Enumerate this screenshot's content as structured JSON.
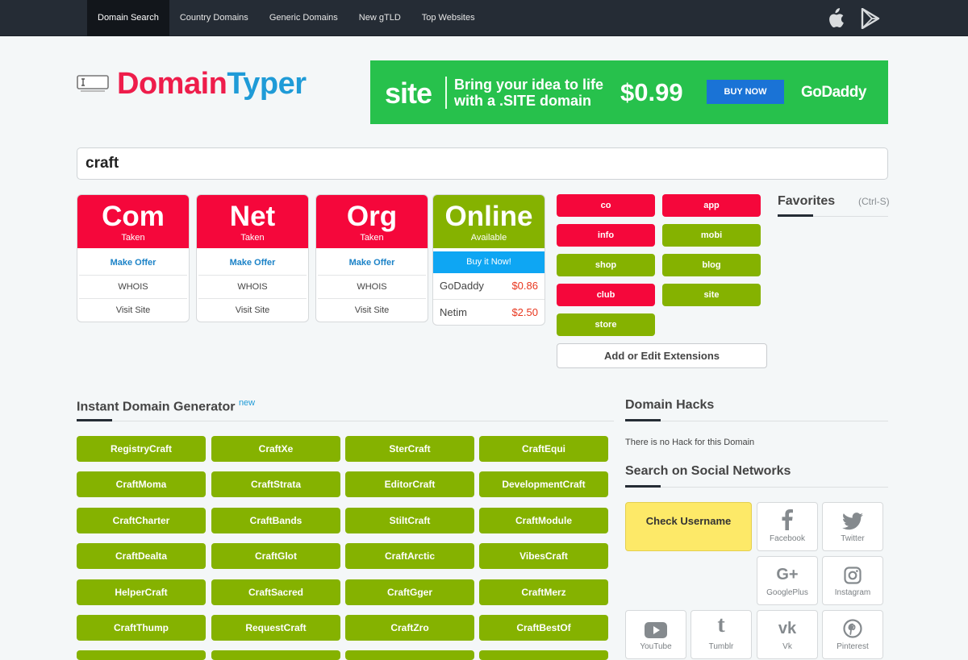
{
  "nav": {
    "items": [
      "Domain Search",
      "Country Domains",
      "Generic Domains",
      "New gTLD",
      "Top Websites"
    ],
    "active": 0
  },
  "logo": {
    "part1": "Domain",
    "part2": "Typer"
  },
  "ad": {
    "brand_word": "site",
    "message": "Bring your idea to life with a .SITE domain",
    "price": "$0.99",
    "button": "BUY NOW",
    "sponsor": "GoDaddy",
    "bg_color": "#27c14c"
  },
  "search": {
    "value": "craft"
  },
  "tld_cards": [
    {
      "name": "Com",
      "status": "Taken",
      "offer": "Make Offer",
      "whois": "WHOIS",
      "visit": "Visit Site"
    },
    {
      "name": "Net",
      "status": "Taken",
      "offer": "Make Offer",
      "whois": "WHOIS",
      "visit": "Visit Site"
    },
    {
      "name": "Org",
      "status": "Taken",
      "offer": "Make Offer",
      "whois": "WHOIS",
      "visit": "Visit Site"
    }
  ],
  "online_card": {
    "name": "Online",
    "status": "Available",
    "buy": "Buy it Now!",
    "registrars": [
      {
        "name": "GoDaddy",
        "price": "$0.86"
      },
      {
        "name": "Netim",
        "price": "$2.50"
      }
    ]
  },
  "extensions": [
    {
      "label": "co",
      "state": "taken"
    },
    {
      "label": "app",
      "state": "taken"
    },
    {
      "label": "info",
      "state": "taken"
    },
    {
      "label": "mobi",
      "state": "available"
    },
    {
      "label": "shop",
      "state": "available"
    },
    {
      "label": "blog",
      "state": "available"
    },
    {
      "label": "club",
      "state": "taken"
    },
    {
      "label": "site",
      "state": "available"
    },
    {
      "label": "store",
      "state": "available"
    }
  ],
  "add_extensions": "Add or Edit Extensions",
  "favorites": {
    "title": "Favorites",
    "shortcut": "(Ctrl-S)"
  },
  "generator": {
    "title": "Instant Domain Generator",
    "badge": "new",
    "items": [
      "RegistryCraft",
      "CraftXe",
      "SterCraft",
      "CraftEqui",
      "CraftMoma",
      "CraftStrata",
      "EditorCraft",
      "DevelopmentCraft",
      "CraftCharter",
      "CraftBands",
      "StiltCraft",
      "CraftModule",
      "CraftDealta",
      "CraftGlot",
      "CraftArctic",
      "VibesCraft",
      "HelperCraft",
      "CraftSacred",
      "CraftGger",
      "CraftMerz",
      "CraftThump",
      "RequestCraft",
      "CraftZro",
      "CraftBestOf",
      "",
      "",
      "",
      ""
    ]
  },
  "hacks": {
    "title": "Domain Hacks",
    "text": "There is no Hack for this Domain"
  },
  "social": {
    "title": "Search on Social Networks",
    "check_label": "Check Username",
    "networks": [
      {
        "label": "Facebook",
        "icon": "facebook-icon"
      },
      {
        "label": "Twitter",
        "icon": "twitter-icon"
      },
      {
        "label": "GooglePlus",
        "icon": "google-plus-icon"
      },
      {
        "label": "Instagram",
        "icon": "instagram-icon"
      },
      {
        "label": "YouTube",
        "icon": "youtube-icon"
      },
      {
        "label": "Tumblr",
        "icon": "tumblr-icon"
      },
      {
        "label": "Vk",
        "icon": "vk-icon"
      },
      {
        "label": "Pinterest",
        "icon": "pinterest-icon"
      }
    ]
  },
  "colors": {
    "taken": "#f5073b",
    "available": "#85b200",
    "accent": "#1f9bd7"
  }
}
